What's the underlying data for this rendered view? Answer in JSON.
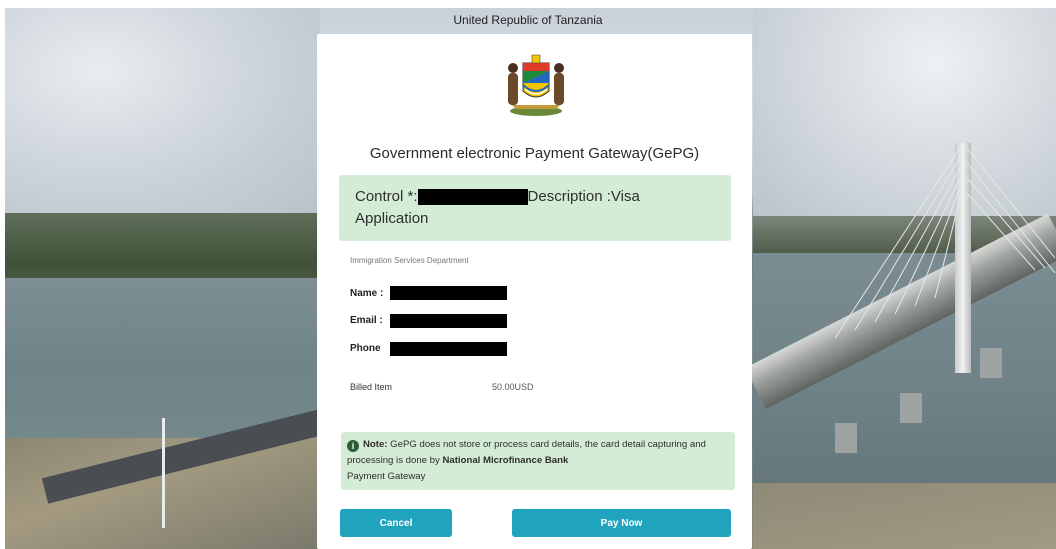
{
  "header": {
    "country": "United Republic of Tanzania"
  },
  "modal": {
    "title": "Government electronic Payment Gateway(GePG)",
    "control_label": "Control *:",
    "description_label": "Description :Visa",
    "description_value": "Application",
    "department": "Immigration Services Department",
    "fields": {
      "name_label": "Name :",
      "email_label": "Email :",
      "phone_label": "Phone"
    },
    "billed_item_label": "Billed Item",
    "billed_item_value": "50.00USD",
    "note": {
      "prefix": "Note:",
      "text_1": " GePG does not store or process card details, the card detail capturing and processing is done by ",
      "bank": "National Microfinance Bank",
      "text_2": "Payment Gateway"
    },
    "buttons": {
      "cancel": "Cancel",
      "pay_now": "Pay Now"
    }
  },
  "colors": {
    "accent_button": "#20a3bd",
    "info_box": "#d4ecd6",
    "redaction": "#000000"
  },
  "icons": {
    "emblem": "tanzania-coat-of-arms",
    "note_icon": "info-circle-icon"
  }
}
